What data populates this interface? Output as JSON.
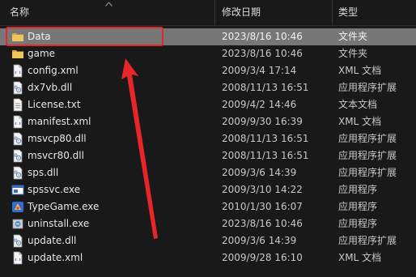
{
  "header": {
    "name_label": "名称",
    "date_label": "修改日期",
    "type_label": "类型"
  },
  "rows": [
    {
      "name": "Data",
      "date": "2023/8/16 10:46",
      "type": "文件夹",
      "icon": "folder-icon",
      "selected": true
    },
    {
      "name": "game",
      "date": "2023/8/16 10:46",
      "type": "文件夹",
      "icon": "folder-icon"
    },
    {
      "name": "config.xml",
      "date": "2009/3/4 17:14",
      "type": "XML 文档",
      "icon": "xml-file-icon"
    },
    {
      "name": "dx7vb.dll",
      "date": "2008/11/13 16:51",
      "type": "应用程序扩展",
      "icon": "dll-file-icon"
    },
    {
      "name": "License.txt",
      "date": "2009/4/2 14:46",
      "type": "文本文档",
      "icon": "text-file-icon"
    },
    {
      "name": "manifest.xml",
      "date": "2009/9/30 16:39",
      "type": "XML 文档",
      "icon": "xml-file-icon"
    },
    {
      "name": "msvcp80.dll",
      "date": "2008/11/13 16:51",
      "type": "应用程序扩展",
      "icon": "dll-file-icon"
    },
    {
      "name": "msvcr80.dll",
      "date": "2008/11/13 16:51",
      "type": "应用程序扩展",
      "icon": "dll-file-icon"
    },
    {
      "name": "sps.dll",
      "date": "2009/3/6 14:39",
      "type": "应用程序扩展",
      "icon": "dll-file-icon"
    },
    {
      "name": "spssvc.exe",
      "date": "2009/3/10 14:22",
      "type": "应用程序",
      "icon": "exe-file-icon"
    },
    {
      "name": "TypeGame.exe",
      "date": "2010/1/30 16:07",
      "type": "应用程序",
      "icon": "typegame-app-icon"
    },
    {
      "name": "uninstall.exe",
      "date": "2023/8/16 10:46",
      "type": "应用程序",
      "icon": "uninstall-app-icon"
    },
    {
      "name": "update.dll",
      "date": "2009/3/6 14:39",
      "type": "应用程序扩展",
      "icon": "dll-file-icon"
    },
    {
      "name": "update.xml",
      "date": "2009/9/28 16:10",
      "type": "XML 文档",
      "icon": "xml-file-icon"
    }
  ],
  "colors": {
    "background": "#191919",
    "selection": "#777777",
    "annotation": "#e8262a",
    "folder": "#e8b84a"
  }
}
